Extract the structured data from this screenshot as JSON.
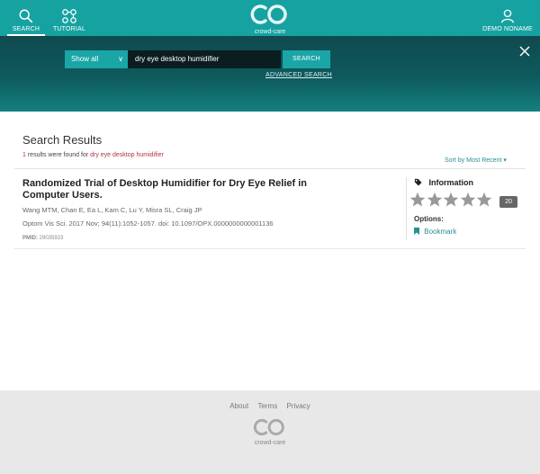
{
  "nav": {
    "search_label": "SEARCH",
    "tutorial_label": "TUTORIAL",
    "user_label": "DEMO NONAME"
  },
  "brand": {
    "name": "crowd-care",
    "accent_color": "#17a2a2",
    "highlight_color": "#b1333d"
  },
  "search": {
    "scope_selected": "Show all",
    "query_value": "dry eye desktop humidifier",
    "button_label": "SEARCH",
    "advanced_label": "ADVANCED SEARCH"
  },
  "results": {
    "heading": "Search Results",
    "count": "1",
    "count_text": " results were found for ",
    "query_echo": "dry eye desktop humidifier",
    "sort_label": "Sort by Most Recent",
    "items": [
      {
        "title": "Randomized Trial of Desktop Humidifier for Dry Eye Relief in Computer Users.",
        "authors": "Wang MTM, Chan E, Ea L, Kam C, Lu Y, Misra SL, Craig JP",
        "citation": "Optom Vis Sci. 2017 Nov; 94(11):1052-1057. doi: 10.1097/OPX.0000000000001136",
        "pmid_label": "PMID:",
        "pmid_value": "29035923",
        "info_label": "Information",
        "stars_total": 5,
        "stars_filled": 0,
        "rating_count": "20",
        "options_label": "Options:",
        "bookmark_label": "Bookmark"
      }
    ]
  },
  "footer": {
    "links": [
      "About",
      "Terms",
      "Privacy"
    ],
    "brand": "crowd-care"
  },
  "icons": {
    "search": "search-icon",
    "tutorial": "tutorial-icon",
    "user": "user-icon",
    "close": "close-icon",
    "tag": "tag-icon",
    "star": "star-icon",
    "bookmark": "bookmark-icon"
  }
}
